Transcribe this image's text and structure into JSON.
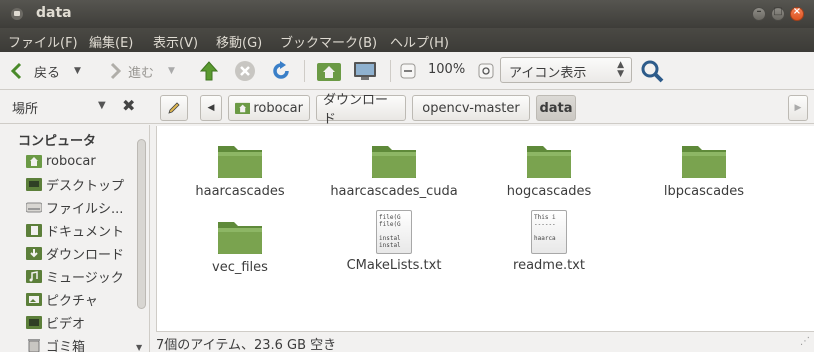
{
  "window": {
    "title": "data"
  },
  "menubar": {
    "items": [
      {
        "label": "ファイル(F)"
      },
      {
        "label": "編集(E)"
      },
      {
        "label": "表示(V)"
      },
      {
        "label": "移動(G)"
      },
      {
        "label": "ブックマーク(B)"
      },
      {
        "label": "ヘルプ(H)"
      }
    ]
  },
  "toolbar": {
    "back_label": "戻る",
    "forward_label": "進む",
    "zoom_level": "100%",
    "view_mode": "アイコン表示"
  },
  "places": {
    "title": "場所",
    "section_heading": "コンピュータ",
    "items": [
      {
        "label": "robocar",
        "icon": "home-folder-icon"
      },
      {
        "label": "デスクトップ",
        "icon": "desktop-icon"
      },
      {
        "label": "ファイルシ...",
        "icon": "drive-icon"
      },
      {
        "label": "ドキュメント",
        "icon": "documents-icon"
      },
      {
        "label": "ダウンロード",
        "icon": "downloads-icon"
      },
      {
        "label": "ミュージック",
        "icon": "music-icon"
      },
      {
        "label": "ピクチャ",
        "icon": "pictures-icon"
      },
      {
        "label": "ビデオ",
        "icon": "videos-icon"
      },
      {
        "label": "ゴミ箱",
        "icon": "trash-icon"
      }
    ]
  },
  "pathbar": {
    "segments": [
      {
        "label": "robocar"
      },
      {
        "label": "ダウンロード"
      },
      {
        "label": "opencv-master"
      },
      {
        "label": "data"
      }
    ]
  },
  "files": [
    {
      "name": "haarcascades",
      "type": "folder"
    },
    {
      "name": "haarcascades_cuda",
      "type": "folder"
    },
    {
      "name": "hogcascades",
      "type": "folder"
    },
    {
      "name": "lbpcascades",
      "type": "folder"
    },
    {
      "name": "vec_files",
      "type": "folder"
    },
    {
      "name": "CMakeLists.txt",
      "type": "text",
      "preview": "file(G\nfile(G\n\ninstal\ninstal"
    },
    {
      "name": "readme.txt",
      "type": "text",
      "preview": "This i\n------\n\nhaarca"
    }
  ],
  "status": {
    "text": "7個のアイテム、23.6 GB 空き"
  },
  "colors": {
    "folder": "#7aa34f",
    "accent": "#dd5421",
    "titlebar": "#3c3b37"
  }
}
